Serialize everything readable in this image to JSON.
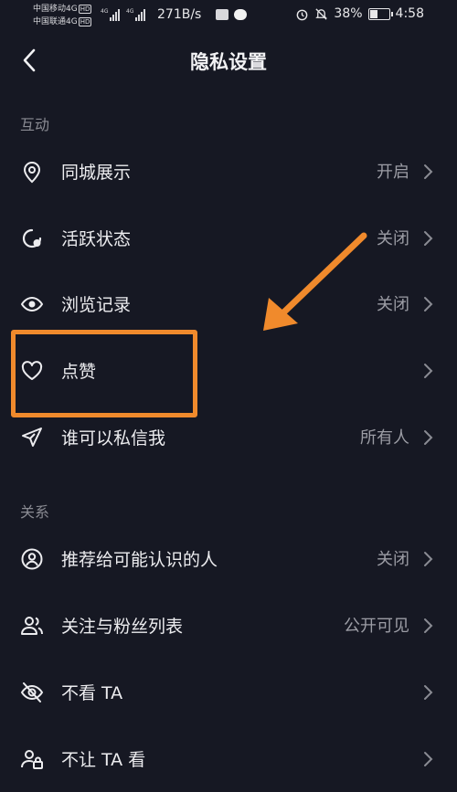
{
  "status_bar": {
    "carrier_1": "中国移动4G",
    "carrier_2": "中国联通4G",
    "hd_badge": "HD",
    "net_tag": "4G",
    "net_speed": "271B/s",
    "battery_percent": "38%",
    "battery_level": 0.38,
    "time": "4:58"
  },
  "header": {
    "title": "隐私设置"
  },
  "sections": [
    {
      "label": "互动"
    },
    {
      "label": "关系"
    }
  ],
  "rows": [
    {
      "label": "同城展示",
      "value": "开启",
      "icon": "location-pin-icon"
    },
    {
      "label": "活跃状态",
      "value": "关闭",
      "icon": "activity-status-icon"
    },
    {
      "label": "浏览记录",
      "value": "关闭",
      "icon": "eye-icon"
    },
    {
      "label": "点赞",
      "value": "",
      "icon": "heart-icon"
    },
    {
      "label": "谁可以私信我",
      "value": "所有人",
      "icon": "send-icon"
    },
    {
      "label": "推荐给可能认识的人",
      "value": "关闭",
      "icon": "user-circle-icon"
    },
    {
      "label": "关注与粉丝列表",
      "value": "公开可见",
      "icon": "users-icon"
    },
    {
      "label": "不看 TA",
      "value": "",
      "icon": "eye-off-icon"
    },
    {
      "label": "不让 TA 看",
      "value": "",
      "icon": "user-lock-icon"
    }
  ],
  "colors": {
    "background": "#161823",
    "annotation": "#f08a2c",
    "secondary_text": "#9c9da5"
  }
}
